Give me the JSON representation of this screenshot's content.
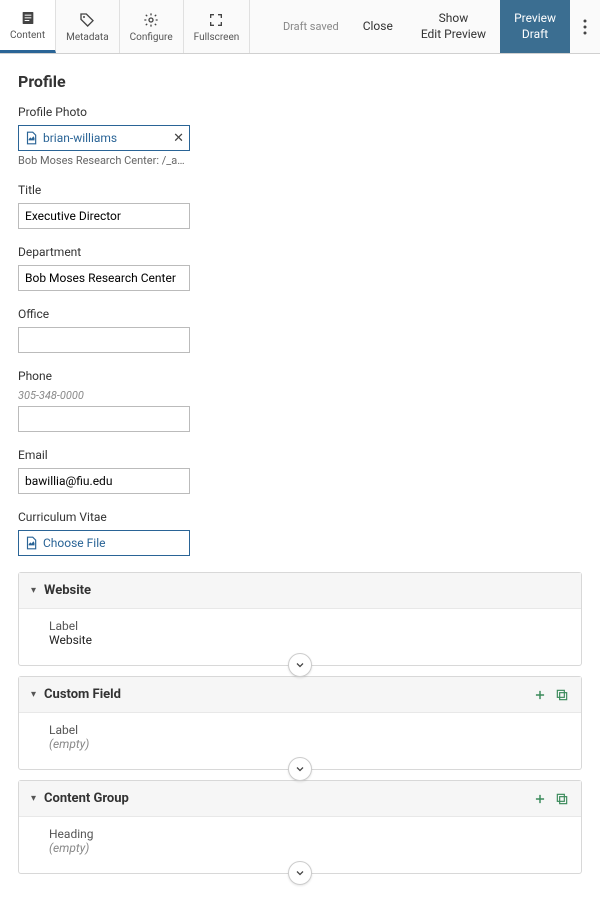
{
  "toolbar": {
    "tabs": [
      {
        "label": "Content"
      },
      {
        "label": "Metadata"
      },
      {
        "label": "Configure"
      },
      {
        "label": "Fullscreen"
      }
    ],
    "status": "Draft saved",
    "close_label": "Close",
    "show_edit_preview_label": "Show\nEdit Preview",
    "preview_draft_label": "Preview\nDraft"
  },
  "page": {
    "title": "Profile"
  },
  "fields": {
    "photo": {
      "label": "Profile Photo",
      "filename": "brian-williams",
      "path": "Bob Moses Research Center: /_assets/image…"
    },
    "title": {
      "label": "Title",
      "value": "Executive Director"
    },
    "department": {
      "label": "Department",
      "value": "Bob Moses Research Center"
    },
    "office": {
      "label": "Office",
      "value": ""
    },
    "phone": {
      "label": "Phone",
      "help": "305-348-0000",
      "value": ""
    },
    "email": {
      "label": "Email",
      "value": "bawillia@fiu.edu"
    },
    "cv": {
      "label": "Curriculum Vitae",
      "choose_label": "Choose File"
    }
  },
  "sections": {
    "website": {
      "title": "Website",
      "kv_label": "Label",
      "kv_value": "Website",
      "empty": false,
      "has_actions": false
    },
    "custom_field": {
      "title": "Custom Field",
      "kv_label": "Label",
      "kv_value": "(empty)",
      "empty": true,
      "has_actions": true
    },
    "content_group": {
      "title": "Content Group",
      "kv_label": "Heading",
      "kv_value": "(empty)",
      "empty": true,
      "has_actions": true
    }
  }
}
